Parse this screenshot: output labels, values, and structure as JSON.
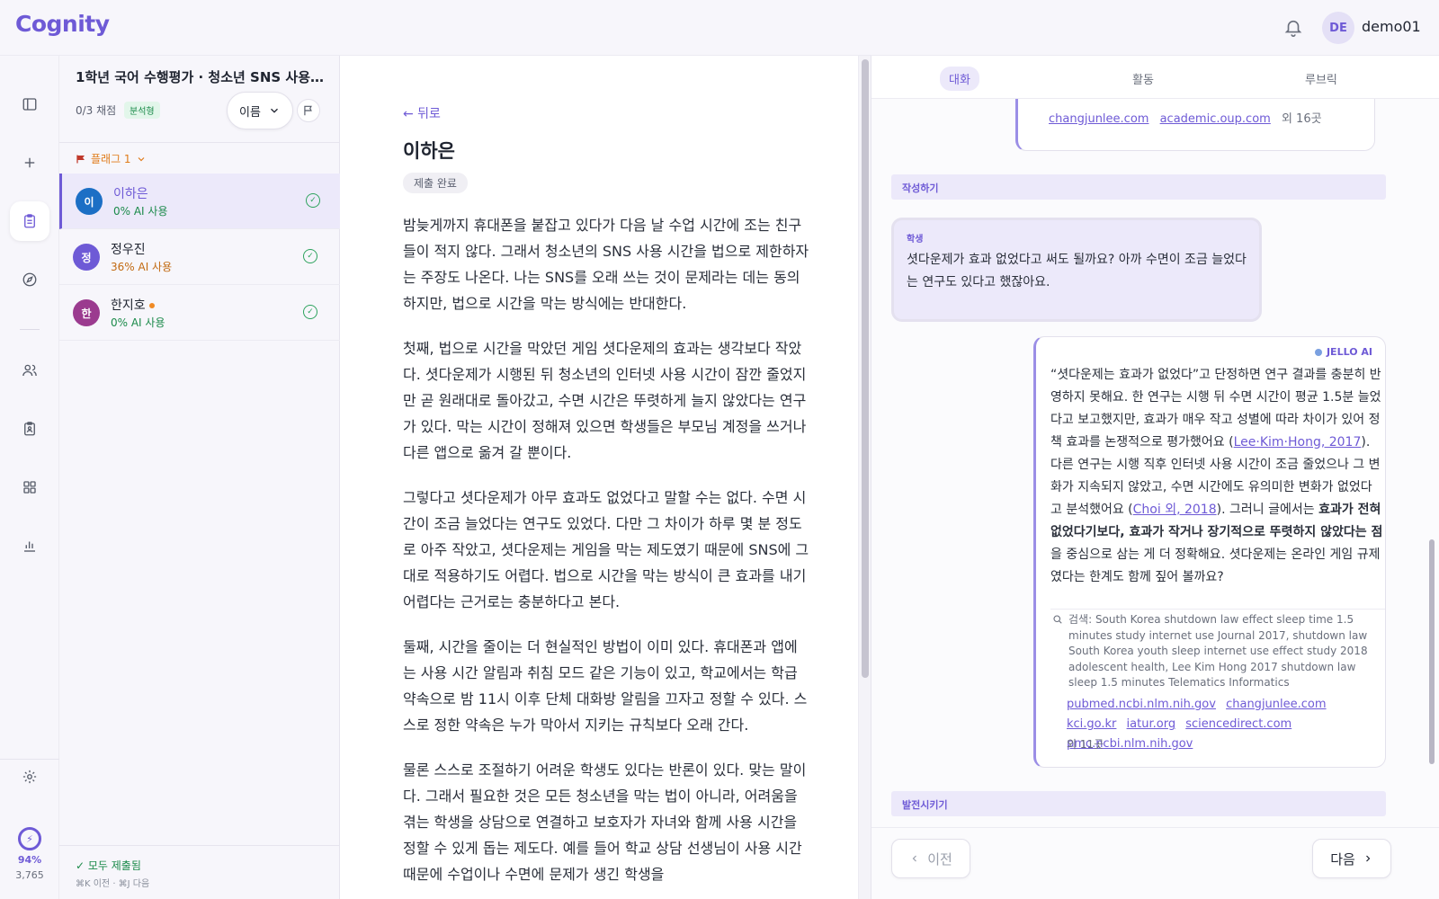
{
  "app": {
    "logo": "Cognity"
  },
  "user": {
    "initials": "DE",
    "name": "demo01"
  },
  "rail": {
    "items": [
      "sidebar-toggle-icon",
      "plus-icon",
      "clipboard-icon",
      "compass-icon",
      "users-icon",
      "clipboard-person-icon",
      "grid-icon",
      "bar-chart-icon"
    ],
    "settings_icon": "gear-icon",
    "usage_pct": "94%",
    "usage_count": "3,765"
  },
  "assignment": {
    "title": "1학년 국어 수행평가 · 청소년 SNS 사용 시...",
    "grading": "0/3 채점",
    "type_badge": "분석형",
    "sort_label": "이름",
    "flag_group": "플래그 1"
  },
  "students": [
    {
      "initial": "이",
      "name": "이하은",
      "ai_usage": "0% AI 사용",
      "color": "#1c6fc5",
      "ai_color": "#1b8a4a",
      "active": true,
      "dot": false
    },
    {
      "initial": "정",
      "name": "정우진",
      "ai_usage": "36% AI 사용",
      "color": "#6e5ad6",
      "ai_color": "#c26a12",
      "active": false,
      "dot": false
    },
    {
      "initial": "한",
      "name": "한지호",
      "ai_usage": "0% AI 사용",
      "color": "#9b3b8f",
      "ai_color": "#1b8a4a",
      "active": false,
      "dot": true
    }
  ],
  "footer": {
    "all_submitted": "✓ 모두 제출됨",
    "shortcuts": "⌘K 이전 · ⌘J 다음"
  },
  "doc": {
    "back": "← 뒤로",
    "student_name": "이하은",
    "status": "제출 완료",
    "paragraphs": [
      "밤늦게까지 휴대폰을 붙잡고 있다가 다음 날 수업 시간에 조는 친구들이 적지 않다. 그래서 청소년의 SNS 사용 시간을 법으로 제한하자는 주장도 나온다. 나는 SNS를 오래 쓰는 것이 문제라는 데는 동의하지만, 법으로 시간을 막는 방식에는 반대한다.",
      "첫째, 법으로 시간을 막았던 게임 셧다운제의 효과는 생각보다 작았다. 셧다운제가 시행된 뒤 청소년의 인터넷 사용 시간이 잠깐 줄었지만 곧 원래대로 돌아갔고, 수면 시간은 뚜렷하게 늘지 않았다는 연구가 있다. 막는 시간이 정해져 있으면 학생들은 부모님 계정을 쓰거나 다른 앱으로 옮겨 갈 뿐이다.",
      "그렇다고 셧다운제가 아무 효과도 없었다고 말할 수는 없다. 수면 시간이 조금 늘었다는 연구도 있었다. 다만 그 차이가 하루 몇 분 정도로 아주 작았고, 셧다운제는 게임을 막는 제도였기 때문에 SNS에 그대로 적용하기도 어렵다. 법으로 시간을 막는 방식이 큰 효과를 내기 어렵다는 근거로는 충분하다고 본다.",
      "둘째, 시간을 줄이는 더 현실적인 방법이 이미 있다. 휴대폰과 앱에는 사용 시간 알림과 취침 모드 같은 기능이 있고, 학교에서는 학급 약속으로 밤 11시 이후 단체 대화방 알림을 끄자고 정할 수 있다. 스스로 정한 약속은 누가 막아서 지키는 규칙보다 오래 간다.",
      "물론 스스로 조절하기 어려운 학생도 있다는 반론이 있다. 맞는 말이다. 그래서 필요한 것은 모든 청소년을 막는 법이 아니라, 어려움을 겪는 학생을 상담으로 연결하고 보호자가 자녀와 함께 사용 시간을 정할 수 있게 돕는 제도다. 예를 들어 학교 상담 선생님이 사용 시간 때문에 수업이나 수면에 문제가 생긴 학생을"
    ]
  },
  "chat": {
    "tabs": [
      "대화",
      "활동",
      "루브릭"
    ],
    "prev_links": [
      "changjunlee.com",
      "academic.oup.com"
    ],
    "prev_more": "외 16곳",
    "section_write": "작성하기",
    "student_label": "학생",
    "student_msg": "셧다운제가 효과 없었다고 써도 될까요? 아까 수면이 조금 늘었다는 연구도 있다고 했잖아요.",
    "ai_label": "JELLO AI",
    "ai_p1": "“셧다운제는 효과가 없었다”고 단정하면 연구 결과를 충분히 반영하지 못해요. 한 연구는 시행 뒤 수면 시간이 평균 1.5분 늘었다고 보고했지만, 효과가 매우 작고 성별에 따라 차이가 있어 정책 효과를 논쟁적으로 평가했어요 (",
    "ai_cite1": "Lee·Kim·Hong, 2017",
    "ai_p2": "). 다른 연구는 시행 직후 인터넷 사용 시간이 조금 줄었으나 그 변화가 지속되지 않았고, 수면 시간에도 유의미한 변화가 없었다고 분석했어요 (",
    "ai_cite2": "Choi 외, 2018",
    "ai_p3": "). 그러니 글에서는 ",
    "ai_bold": "효과가 전혀 없었다기보다, 효과가 작거나 장기적으로 뚜렷하지 않았다는 점",
    "ai_p4": "을 중심으로 삼는 게 더 정확해요. 셧다운제는 온라인 게임 규제였다는 한계도 함께 짚어 볼까요?",
    "search": "검색: South Korea shutdown law effect sleep time 1.5 minutes study internet use Journal 2017, shutdown law South Korea youth sleep internet use effect study 2018 adolescent health, Lee Kim Hong 2017 shutdown law sleep 1.5 minutes Telematics Informatics",
    "sources": [
      "pubmed.ncbi.nlm.nih.gov",
      "changjunlee.com",
      "kci.go.kr",
      "iatur.org",
      "sciencedirect.com",
      "pmc.ncbi.nlm.nih.gov"
    ],
    "sources_more": "외 11곳",
    "section_develop": "발전시키기",
    "prev_btn": "이전",
    "next_btn": "다음"
  }
}
